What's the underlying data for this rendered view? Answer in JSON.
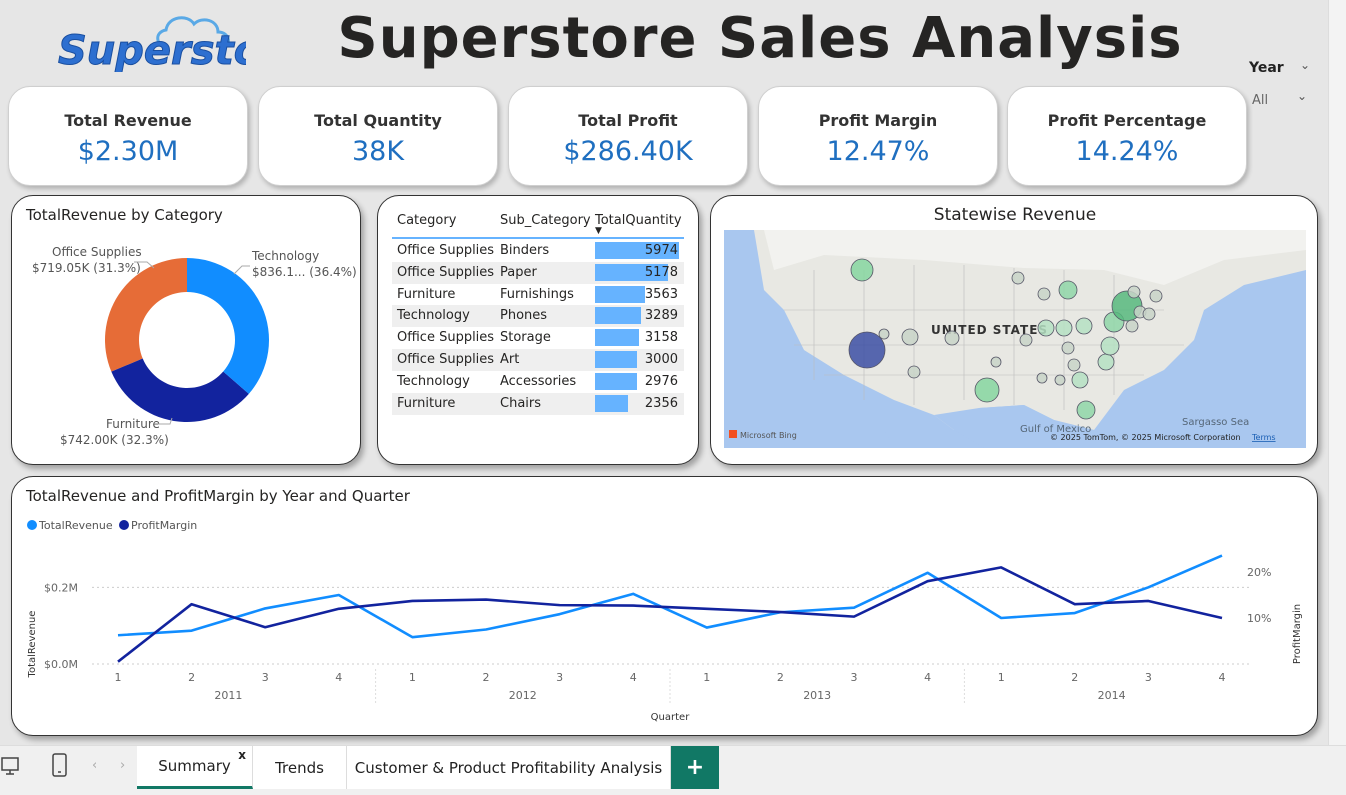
{
  "header": {
    "logo_text": "Superstore",
    "title": "Superstore Sales Analysis"
  },
  "slicer": {
    "label": "Year",
    "value": "All"
  },
  "kpis": [
    {
      "label": "Total Revenue",
      "value": "$2.30M"
    },
    {
      "label": "Total Quantity",
      "value": "38K"
    },
    {
      "label": "Total Profit",
      "value": "$286.40K"
    },
    {
      "label": "Profit Margin",
      "value": "12.47%"
    },
    {
      "label": "Profit Percentage",
      "value": "14.24%"
    }
  ],
  "donut": {
    "title": "TotalRevenue by Category",
    "slices": [
      {
        "name": "Technology",
        "label": "$836.1... (36.4%)",
        "share": 36.4,
        "color": "#118dff"
      },
      {
        "name": "Furniture",
        "label": "$742.00K (32.3%)",
        "share": 32.3,
        "color": "#12239e"
      },
      {
        "name": "Office Supplies",
        "label": "$719.05K (31.3%)",
        "share": 31.3,
        "color": "#e66c37"
      }
    ]
  },
  "table": {
    "headers": [
      "Category",
      "Sub_Category",
      "TotalQuantity"
    ],
    "rows": [
      {
        "category": "Office Supplies",
        "sub": "Binders",
        "qty": 5974
      },
      {
        "category": "Office Supplies",
        "sub": "Paper",
        "qty": 5178
      },
      {
        "category": "Furniture",
        "sub": "Furnishings",
        "qty": 3563
      },
      {
        "category": "Technology",
        "sub": "Phones",
        "qty": 3289
      },
      {
        "category": "Office Supplies",
        "sub": "Storage",
        "qty": 3158
      },
      {
        "category": "Office Supplies",
        "sub": "Art",
        "qty": 3000
      },
      {
        "category": "Technology",
        "sub": "Accessories",
        "qty": 2976
      },
      {
        "category": "Furniture",
        "sub": "Chairs",
        "qty": 2356
      }
    ]
  },
  "map": {
    "title": "Statewise Revenue",
    "country_label": "UNITED STATES",
    "gulf_label": "Gulf of Mexico",
    "sea_label": "Sargasso Sea",
    "attribution": "© 2025 TomTom, © 2025 Microsoft Corporation",
    "terms": "Terms",
    "bing": "Microsoft Bing"
  },
  "chart_data": {
    "type": "line",
    "title": "TotalRevenue and ProfitMargin by Year and Quarter",
    "xlabel": "Quarter",
    "ylabel": "TotalRevenue",
    "y2label": "ProfitMargin",
    "categories": [
      "1",
      "2",
      "3",
      "4",
      "1",
      "2",
      "3",
      "4",
      "1",
      "2",
      "3",
      "4",
      "1",
      "2",
      "3",
      "4"
    ],
    "years": [
      "2011",
      "2012",
      "2013",
      "2014"
    ],
    "y_ticks": [
      "$0.0M",
      "$0.2M"
    ],
    "y2_ticks": [
      "10%",
      "20%"
    ],
    "ylim": [
      0,
      0.3
    ],
    "y2lim": [
      0,
      0.25
    ],
    "legend_position": "top-left",
    "series": [
      {
        "name": "TotalRevenue",
        "axis": "left",
        "color": "#118dff",
        "values": [
          0.075,
          0.087,
          0.145,
          0.18,
          0.07,
          0.09,
          0.13,
          0.183,
          0.095,
          0.135,
          0.147,
          0.238,
          0.12,
          0.133,
          0.2,
          0.283
        ]
      },
      {
        "name": "ProfitMargin",
        "axis": "right",
        "color": "#12239e",
        "values": [
          0.005,
          0.13,
          0.08,
          0.12,
          0.137,
          0.14,
          0.128,
          0.127,
          0.12,
          0.113,
          0.103,
          0.18,
          0.21,
          0.13,
          0.137,
          0.1
        ]
      }
    ]
  },
  "tabs": [
    {
      "label": "Summary",
      "active": true
    },
    {
      "label": "Trends"
    },
    {
      "label": "Customer & Product Profitability Analysis"
    }
  ],
  "tab_add": "+",
  "tab_close": "x"
}
